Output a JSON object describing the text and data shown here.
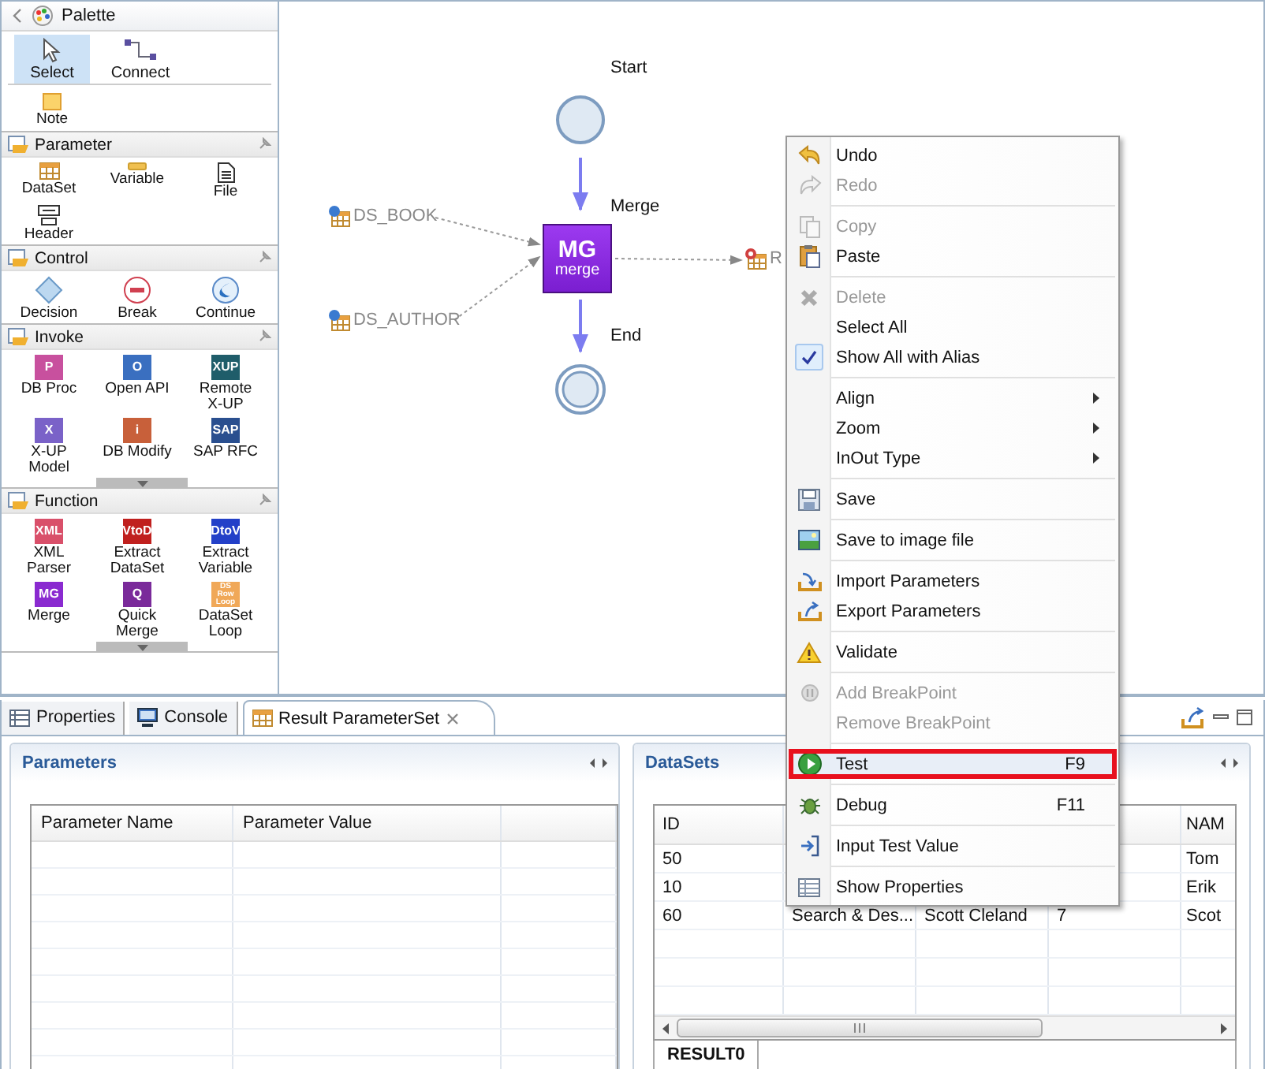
{
  "palette": {
    "title": "Palette",
    "tools": [
      {
        "label": "Select",
        "kind": "select",
        "selected": true
      },
      {
        "label": "Connect",
        "kind": "connect",
        "selected": false
      }
    ],
    "extra": [
      {
        "label": "Note",
        "kind": "note"
      }
    ],
    "groups": [
      {
        "title": "Parameter",
        "scrollable": false,
        "items": [
          {
            "label": "DataSet",
            "kind": "dataset"
          },
          {
            "label": "Variable",
            "kind": "variable"
          },
          {
            "label": "File",
            "kind": "file"
          },
          {
            "label": "Header",
            "kind": "header"
          }
        ]
      },
      {
        "title": "Control",
        "scrollable": false,
        "items": [
          {
            "label": "Decision",
            "kind": "decision"
          },
          {
            "label": "Break",
            "kind": "break"
          },
          {
            "label": "Continue",
            "kind": "continue"
          }
        ]
      },
      {
        "title": "Invoke",
        "scrollable": true,
        "items": [
          {
            "label": "DB Proc",
            "kind": "badge",
            "badge": "P",
            "color": "#c8509e"
          },
          {
            "label": "Open API",
            "kind": "badge",
            "badge": "O",
            "color": "#3a6fc0"
          },
          {
            "label": "Remote X-UP",
            "kind": "badge",
            "badge": "XUP",
            "color": "#1f5d6a"
          },
          {
            "label": "X-UP Model",
            "kind": "badge",
            "badge": "X",
            "color": "#7a62c8"
          },
          {
            "label": "DB Modify",
            "kind": "badge",
            "badge": "i",
            "color": "#c8603a"
          },
          {
            "label": "SAP RFC",
            "kind": "badge",
            "badge": "SAP",
            "color": "#2a4f8f"
          }
        ]
      },
      {
        "title": "Function",
        "scrollable": true,
        "items": [
          {
            "label": "XML Parser",
            "kind": "badge",
            "badge": "XML",
            "color": "#d9506a"
          },
          {
            "label": "Extract DataSet",
            "kind": "badge",
            "badge": "VtoD",
            "color": "#c0201e"
          },
          {
            "label": "Extract Variable",
            "kind": "badge",
            "badge": "DtoV",
            "color": "#2340c8"
          },
          {
            "label": "Merge",
            "kind": "badge",
            "badge": "MG",
            "color": "#8a2ad0"
          },
          {
            "label": "Quick Merge",
            "kind": "badge",
            "badge": "Q",
            "color": "#7a2a9a"
          },
          {
            "label": "DataSet Loop",
            "kind": "badge",
            "badge": "DS Row Loop",
            "color": "#f0a858"
          }
        ]
      }
    ]
  },
  "diagram": {
    "start_label": "Start",
    "merge_label": "Merge",
    "merge_badge": "MG",
    "merge_caption": "merge",
    "end_label": "End",
    "inputs": [
      "DS_BOOK",
      "DS_AUTHOR"
    ],
    "output": "R"
  },
  "menu": [
    {
      "kind": "item",
      "label": "Undo",
      "disabled": false,
      "checked": false,
      "submenu": false,
      "selected": false
    },
    {
      "kind": "item",
      "label": "Redo",
      "disabled": true,
      "checked": false,
      "submenu": false,
      "selected": false
    },
    {
      "kind": "separator"
    },
    {
      "kind": "item",
      "label": "Copy",
      "disabled": true,
      "checked": false,
      "submenu": false,
      "selected": false
    },
    {
      "kind": "item",
      "label": "Paste",
      "disabled": false,
      "checked": false,
      "submenu": false,
      "selected": false
    },
    {
      "kind": "separator"
    },
    {
      "kind": "item",
      "label": "Delete",
      "disabled": true,
      "checked": false,
      "submenu": false,
      "selected": false
    },
    {
      "kind": "item",
      "label": "Select All",
      "disabled": false,
      "checked": false,
      "submenu": false,
      "selected": false
    },
    {
      "kind": "item",
      "label": "Show All with Alias",
      "disabled": false,
      "checked": true,
      "submenu": false,
      "selected": false
    },
    {
      "kind": "separator"
    },
    {
      "kind": "item",
      "label": "Align",
      "disabled": false,
      "checked": false,
      "submenu": true,
      "selected": false
    },
    {
      "kind": "item",
      "label": "Zoom",
      "disabled": false,
      "checked": false,
      "submenu": true,
      "selected": false
    },
    {
      "kind": "item",
      "label": "InOut Type",
      "disabled": false,
      "checked": false,
      "submenu": true,
      "selected": false
    },
    {
      "kind": "separator"
    },
    {
      "kind": "item",
      "label": "Save",
      "disabled": false,
      "checked": false,
      "submenu": false,
      "selected": false
    },
    {
      "kind": "separator"
    },
    {
      "kind": "item",
      "label": "Save to image file",
      "disabled": false,
      "checked": false,
      "submenu": false,
      "selected": false
    },
    {
      "kind": "separator"
    },
    {
      "kind": "item",
      "label": "Import Parameters",
      "disabled": false,
      "checked": false,
      "submenu": false,
      "selected": false
    },
    {
      "kind": "item",
      "label": "Export Parameters",
      "disabled": false,
      "checked": false,
      "submenu": false,
      "selected": false
    },
    {
      "kind": "separator"
    },
    {
      "kind": "item",
      "label": "Validate",
      "disabled": false,
      "checked": false,
      "submenu": false,
      "selected": false
    },
    {
      "kind": "separator"
    },
    {
      "kind": "item",
      "label": "Add BreakPoint",
      "disabled": true,
      "checked": false,
      "submenu": false,
      "selected": false
    },
    {
      "kind": "item",
      "label": "Remove BreakPoint",
      "disabled": true,
      "checked": false,
      "submenu": false,
      "selected": false
    },
    {
      "kind": "separator"
    },
    {
      "kind": "item",
      "label": "Test",
      "shortcut": "F9",
      "disabled": false,
      "checked": false,
      "submenu": false,
      "selected": true
    },
    {
      "kind": "separator"
    },
    {
      "kind": "item",
      "label": "Debug",
      "shortcut": "F11",
      "disabled": false,
      "checked": false,
      "submenu": false,
      "selected": false
    },
    {
      "kind": "separator"
    },
    {
      "kind": "item",
      "label": "Input Test Value",
      "disabled": false,
      "checked": false,
      "submenu": false,
      "selected": false
    },
    {
      "kind": "separator"
    },
    {
      "kind": "item",
      "label": "Show Properties",
      "disabled": false,
      "checked": false,
      "submenu": false,
      "selected": false
    }
  ],
  "bottom_tabs": [
    {
      "label": "Properties",
      "selected": false,
      "closable": false
    },
    {
      "label": "Console",
      "selected": false,
      "closable": false
    },
    {
      "label": "Result ParameterSet",
      "selected": true,
      "closable": true
    }
  ],
  "parameters": {
    "title": "Parameters",
    "columns": [
      "Parameter Name",
      "Parameter Value"
    ]
  },
  "datasets": {
    "title": "DataSets",
    "columns": [
      "ID",
      null,
      null,
      null,
      "NAM"
    ],
    "rows": [
      [
        "50",
        null,
        null,
        null,
        "Tom"
      ],
      [
        "10",
        null,
        null,
        null,
        "Erik"
      ],
      [
        "60",
        "Search & Des...",
        "Scott Cleland",
        "7",
        "Scot"
      ]
    ],
    "tabs": [
      {
        "label": "RESULT0",
        "selected": true
      }
    ]
  }
}
